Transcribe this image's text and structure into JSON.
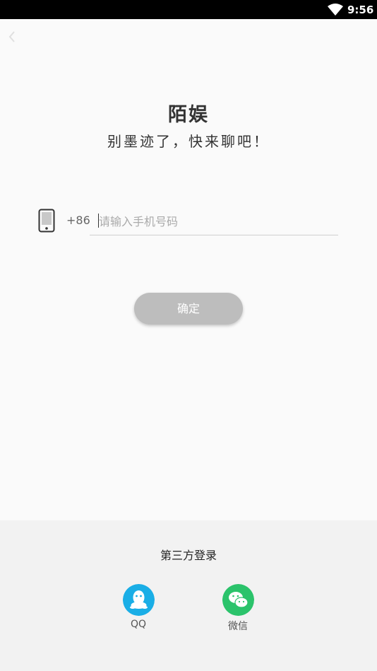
{
  "status_bar": {
    "time": "9:56"
  },
  "header": {
    "app_title": "陌娱",
    "slogan": "别墨迹了，快来聊吧！"
  },
  "login": {
    "country_code": "+86",
    "phone_placeholder": "请输入手机号码",
    "phone_value": "",
    "confirm_label": "确定"
  },
  "third_party": {
    "title": "第三方登录",
    "qq_label": "QQ",
    "wechat_label": "微信"
  },
  "colors": {
    "qq": "#1aaee6",
    "wechat": "#2bc36b",
    "confirm_disabled": "#bdbdbd"
  }
}
